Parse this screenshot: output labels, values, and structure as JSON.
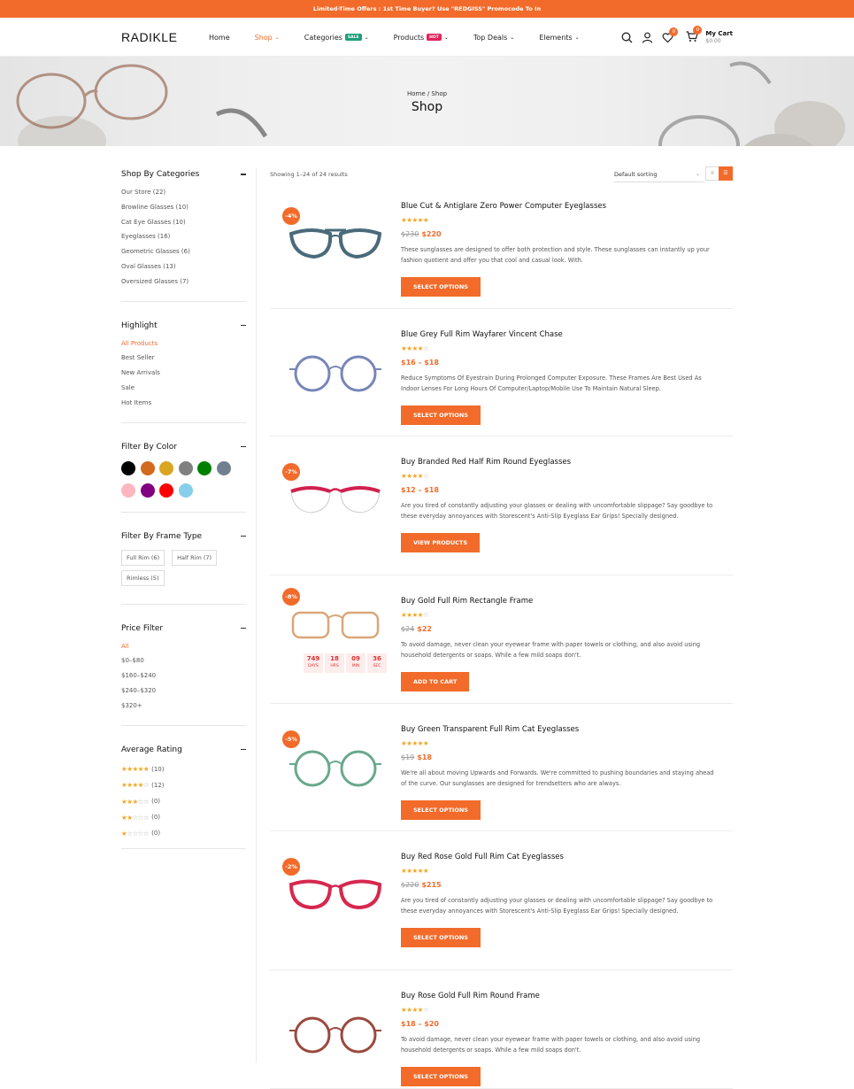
{
  "topbar": {
    "text": "Limited-Time Offers : 1st Time Buyer? Use \"REDGISS\" Promocode To In"
  },
  "header": {
    "logo": "RADIKLE",
    "nav": [
      {
        "label": "Home",
        "active": false
      },
      {
        "label": "Shop",
        "active": true
      },
      {
        "label": "Categories",
        "badge": "SALE",
        "badge_color": "#1e9e7a"
      },
      {
        "label": "Products",
        "badge": "HOT",
        "badge_color": "#e0245e"
      },
      {
        "label": "Top Deals"
      },
      {
        "label": "Elements"
      }
    ],
    "wishlist_count": "0",
    "cart_count": "0",
    "cart_label": "My Cart",
    "cart_total": "$0.00"
  },
  "banner": {
    "breadcrumb": "Home / Shop",
    "title": "Shop"
  },
  "sidebar": {
    "categories": {
      "title": "Shop By Categories",
      "items": [
        "Our Store (22)",
        "Browline Glasses (10)",
        "Cat Eye Glasses (10)",
        "Eyeglasses (16)",
        "Geometric Glasses (6)",
        "Oval Glasses (13)",
        "Oversized Glasses (7)"
      ]
    },
    "highlight": {
      "title": "Highlight",
      "items": [
        "All Products",
        "Best Seller",
        "New Arrivals",
        "Sale",
        "Hot Items"
      ]
    },
    "color": {
      "title": "Filter By Color",
      "swatches": [
        "#000000",
        "#d2691e",
        "#daa520",
        "#808080",
        "#008000",
        "#708090",
        "#ffb6c1",
        "#800080",
        "#ff0000",
        "#87ceeb"
      ]
    },
    "frame": {
      "title": "Filter By Frame Type",
      "items": [
        "Full Rim (6)",
        "Half Rim (7)",
        "Rimless (5)"
      ]
    },
    "price": {
      "title": "Price Filter",
      "items": [
        "All",
        "$0–$80",
        "$160–$240",
        "$240–$320",
        "$320+"
      ]
    },
    "rating": {
      "title": "Average Rating",
      "items": [
        {
          "stars": 5,
          "count": "(10)"
        },
        {
          "stars": 4,
          "count": "(12)"
        },
        {
          "stars": 3,
          "count": "(0)"
        },
        {
          "stars": 2,
          "count": "(0)"
        },
        {
          "stars": 1,
          "count": "(0)"
        }
      ]
    }
  },
  "toolbar": {
    "result_count": "Showing 1–24 of 24 results",
    "sort": "Default sorting"
  },
  "countdown": [
    {
      "value": "749",
      "label": "DAYS"
    },
    {
      "value": "18",
      "label": "HRS"
    },
    {
      "value": "09",
      "label": "MIN"
    },
    {
      "value": "36",
      "label": "SEC"
    }
  ],
  "products": [
    {
      "title": "Blue Cut & Antiglare Zero Power Computer Eyeglasses",
      "badge": "-4%",
      "rating": 5,
      "old_price": "$230",
      "price": "$220",
      "desc": "These sunglasses are designed to offer both protection and style. These sunglasses can instantly up your fashion quotient and offer you that cool and casual look. With.",
      "button": "SELECT OPTIONS",
      "frame_color": "#4a6a7a",
      "shape": "aviator"
    },
    {
      "title": "Blue Grey Full Rim Wayfarer Vincent Chase",
      "badge": "",
      "rating": 4,
      "old_price": "",
      "price": "$16 – $18",
      "desc": "Reduce Symptoms Of Eyestrain During Prolonged Computer Exposure. These Frames Are Best Used As Indoor Lenses For Long Hours Of Computer/Laptop/Mobile Use To Maintain Natural Sleep.",
      "button": "SELECT OPTIONS",
      "frame_color": "#7a86b8",
      "shape": "round"
    },
    {
      "title": "Buy Branded Red Half Rim Round Eyeglasses",
      "badge": "-7%",
      "rating": 4,
      "old_price": "",
      "price": "$12 – $18",
      "desc": "Are you tired of constantly adjusting your glasses or dealing with uncomfortable slippage? Say goodbye to these everyday annoyances with Storescent's Anti-Slip Eyeglass Ear Grips! Specially designed.",
      "button": "VIEW PRODUCTS",
      "frame_color": "#d0214f",
      "shape": "half"
    },
    {
      "title": "Buy Gold Full Rim Rectangle Frame",
      "badge": "-8%",
      "rating": 4,
      "old_price": "$24",
      "price": "$22",
      "desc": "To avoid damage, never clean your eyewear frame with paper towels or clothing, and also avoid using household detergents or soaps. While a few mild soaps don't.",
      "button": "ADD TO CART",
      "frame_color": "#d9a77a",
      "shape": "rect"
    },
    {
      "title": "Buy Green Transparent Full Rim Cat Eyeglasses",
      "badge": "-5%",
      "rating": 5,
      "old_price": "$19",
      "price": "$18",
      "desc": "We're all about moving Upwards and Forwards. We're committed to pushing boundaries and staying ahead of the curve. Our sunglasses are designed for trendsetters who are always.",
      "button": "SELECT OPTIONS",
      "frame_color": "#6aa88e",
      "shape": "round"
    },
    {
      "title": "Buy Red Rose Gold Full Rim Cat Eyeglasses",
      "badge": "-2%",
      "rating": 5,
      "old_price": "$220",
      "price": "$215",
      "desc": "Are you tired of constantly adjusting your glasses or dealing with uncomfortable slippage? Say goodbye to these everyday annoyances with Storescent's Anti-Slip Eyeglass Ear Grips! Specially designed.",
      "button": "SELECT OPTIONS",
      "frame_color": "#d6284f",
      "shape": "cat"
    },
    {
      "title": "Buy Rose Gold Full Rim Round Frame",
      "badge": "",
      "rating": 4,
      "old_price": "",
      "price": "$18 – $20",
      "desc": "To avoid damage, never clean your eyewear frame with paper towels or clothing, and also avoid using household detergents or soaps. While a few mild soaps don't.",
      "button": "SELECT OPTIONS",
      "frame_color": "#9a4a3e",
      "shape": "round"
    }
  ]
}
